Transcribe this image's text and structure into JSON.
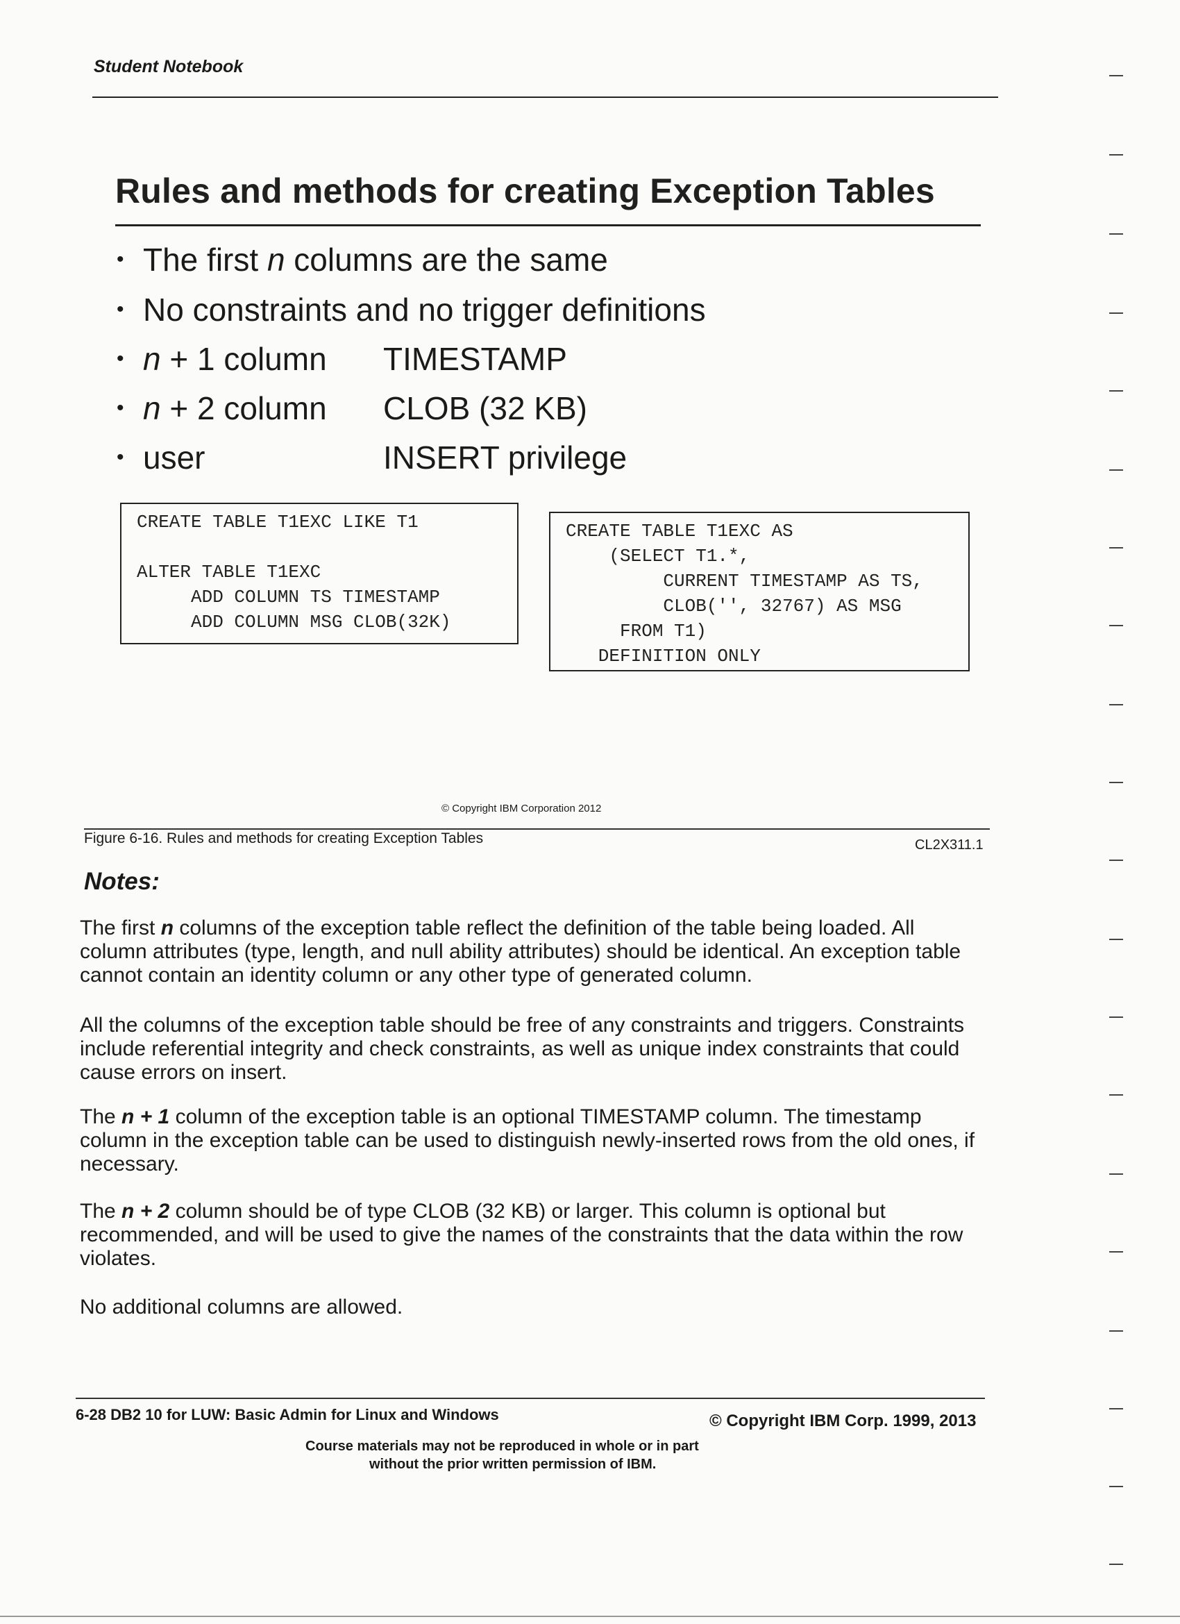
{
  "header": {
    "running_title": "Student Notebook"
  },
  "slide": {
    "title": "Rules and methods for creating Exception Tables",
    "bullets": [
      {
        "term_pre": "The first ",
        "term_italic": "n",
        "term_post": " columns are the same",
        "value": ""
      },
      {
        "term_pre": "No constraints and no trigger definitions",
        "term_italic": "",
        "term_post": "",
        "value": ""
      },
      {
        "term_pre": "",
        "term_italic": "n",
        "term_post": " + 1 column",
        "value": "TIMESTAMP"
      },
      {
        "term_pre": "",
        "term_italic": "n",
        "term_post": " + 2 column",
        "value": "CLOB (32 KB)"
      },
      {
        "term_pre": "user",
        "term_italic": "",
        "term_post": "",
        "value": "INSERT privilege"
      }
    ],
    "code_left": [
      "CREATE TABLE T1EXC LIKE T1",
      "",
      "ALTER TABLE T1EXC",
      "     ADD COLUMN TS TIMESTAMP",
      "     ADD COLUMN MSG CLOB(32K)"
    ],
    "code_right": [
      "CREATE TABLE T1EXC AS",
      "    (SELECT T1.*,",
      "         CURRENT TIMESTAMP AS TS,",
      "         CLOB('', 32767) AS MSG",
      "     FROM T1)",
      "   DEFINITION ONLY"
    ],
    "copyright": "© Copyright IBM Corporation 2012"
  },
  "figure": {
    "caption": "Figure 6-16.  Rules and methods for creating Exception Tables",
    "code": "CL2X311.1"
  },
  "notes": {
    "heading": "Notes:",
    "paragraphs": [
      {
        "pre": "The first ",
        "bold": "n",
        "post": " columns of the exception table reflect the definition of the table being loaded. All column attributes (type, length, and null ability attributes) should be identical. An exception table cannot contain an identity column or any other type of generated column."
      },
      {
        "pre": "All the columns of the exception table should be free of any constraints and triggers. Constraints include referential integrity and check constraints, as well as unique index constraints that could cause errors on insert.",
        "bold": "",
        "post": ""
      },
      {
        "pre": "The ",
        "bold": "n + 1",
        "post": " column of the exception table is an optional TIMESTAMP column. The timestamp column in the exception table can be used to distinguish newly-inserted rows from the old ones, if necessary."
      },
      {
        "pre": "The ",
        "bold": "n + 2",
        "post": " column should be of type CLOB (32 KB) or larger. This column is optional but recommended, and will be used to give the names of the constraints that the data within the row violates."
      },
      {
        "pre": "No additional columns are allowed.",
        "bold": "",
        "post": ""
      }
    ]
  },
  "footer": {
    "left": "6-28  DB2 10 for LUW: Basic Admin for Linux and Windows",
    "right": "© Copyright IBM Corp. 1999, 2013",
    "center_line1": "Course materials may not be reproduced in whole or in part",
    "center_line2": "without the prior written permission of IBM."
  }
}
